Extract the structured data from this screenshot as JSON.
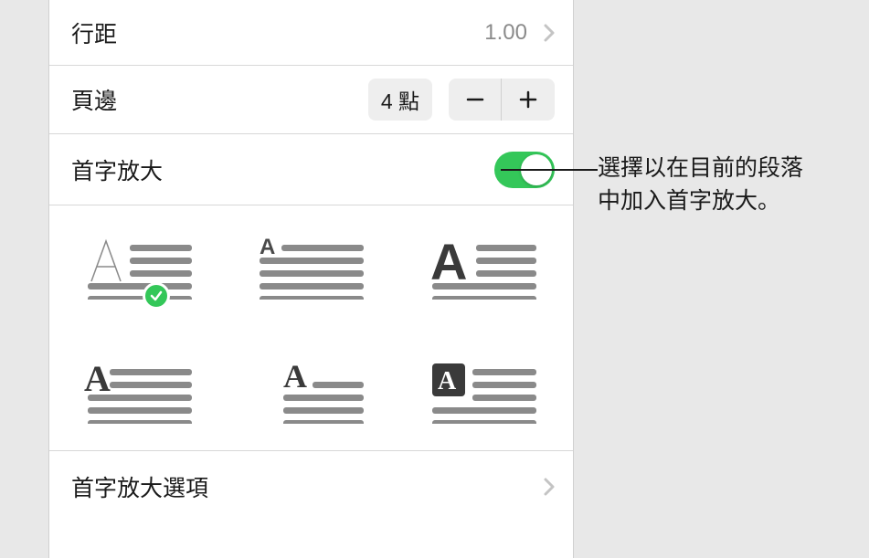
{
  "rows": {
    "lineSpacing": {
      "label": "行距",
      "value": "1.00"
    },
    "margins": {
      "label": "頁邊",
      "value": "4 點"
    },
    "dropCap": {
      "label": "首字放大",
      "enabled": true
    },
    "options": {
      "label": "首字放大選項"
    }
  },
  "callout": {
    "line1": "選擇以在目前的段落",
    "line2": "中加入首字放大。"
  },
  "colors": {
    "accent": "#34c759"
  },
  "dropCapStyles": [
    {
      "id": "style-1",
      "selected": true
    },
    {
      "id": "style-2",
      "selected": false
    },
    {
      "id": "style-3",
      "selected": false
    },
    {
      "id": "style-4",
      "selected": false
    },
    {
      "id": "style-5",
      "selected": false
    },
    {
      "id": "style-6",
      "selected": false
    }
  ]
}
